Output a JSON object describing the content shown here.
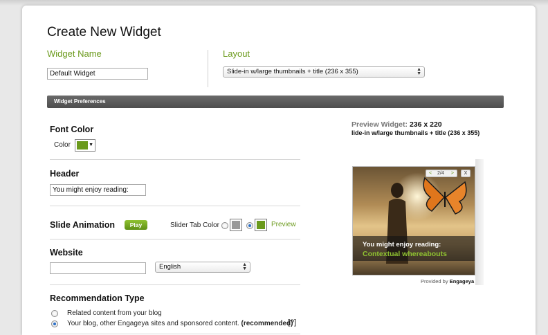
{
  "page": {
    "title": "Create New Widget"
  },
  "widget_name": {
    "label": "Widget Name",
    "value": "Default Widget"
  },
  "layout": {
    "label": "Layout",
    "selected": "Slide-in w/large thumbnails + title (236 x 355)"
  },
  "preferences_bar": {
    "label": "Widget Preferences"
  },
  "font_color": {
    "title": "Font Color",
    "color_label": "Color",
    "color_value": "#6b9a1c"
  },
  "header": {
    "title": "Header",
    "value": "You might enjoy reading:"
  },
  "slide_animation": {
    "title": "Slide Animation",
    "play_label": "Play",
    "slider_tab_color_label": "Slider Tab Color",
    "option_grey_color": "#9a9a9a",
    "option_green_color": "#6b9a1c",
    "selected_option": "green",
    "preview_label": "Preview"
  },
  "website": {
    "title": "Website",
    "value": "",
    "language_selected": "English"
  },
  "recommendation_type": {
    "title": "Recommendation Type",
    "options": [
      {
        "label": "Related content from your blog",
        "selected": false
      },
      {
        "label": "Your blog, other Engageya sites and sponsored content.",
        "suffix": "(recommended)",
        "selected": true
      }
    ],
    "help_label": "[?]"
  },
  "preview": {
    "heading_label": "Preview Widget:",
    "heading_size": "236 x 220",
    "layout_name": "lide-in w/large thumbnails + title (236 x 355)",
    "nav_prev": "<",
    "nav_counter": "2/4",
    "nav_next": ">",
    "close": "X",
    "caption_header": "You might enjoy reading:",
    "caption_title": "Contextual whereabouts",
    "provided_by_label": "Provided by",
    "provided_by_brand": "Engageya"
  },
  "colors": {
    "accent_green": "#6b9a1c",
    "bar_dark": "#555555",
    "caption_green": "#8fc231"
  }
}
